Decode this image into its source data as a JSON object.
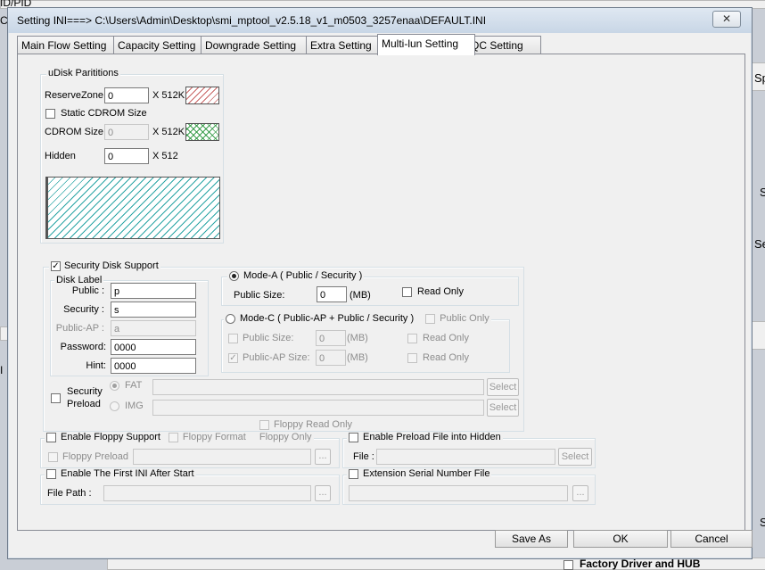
{
  "window": {
    "title": "Setting  INI===> C:\\Users\\Admin\\Desktop\\smi_mptool_v2.5.18_v1_m0503_3257enaa\\DEFAULT.INI",
    "close_glyph": "✕"
  },
  "tabs": [
    {
      "label": "Main Flow Setting"
    },
    {
      "label": "Capacity Setting"
    },
    {
      "label": "Downgrade Setting"
    },
    {
      "label": "Extra Setting"
    },
    {
      "label": "Multi-lun Setting",
      "active": true
    },
    {
      "label": "QC Setting"
    }
  ],
  "udisk": {
    "title": "uDisk Parititions",
    "reserve_label": "ReserveZone",
    "reserve_value": "0",
    "reserve_unit": "X 512K",
    "static_cdrom_label": "Static CDROM Size",
    "cdrom_label": "CDROM Size",
    "cdrom_value": "0",
    "cdrom_unit": "X 512K",
    "hidden_label": "Hidden",
    "hidden_value": "0",
    "hidden_unit": "X 512"
  },
  "security": {
    "title": "Security Disk Support",
    "checked": true,
    "disk_label_title": "Disk Label",
    "public_label": "Public :",
    "public_value": "p",
    "security_label": "Security :",
    "security_value": "s",
    "public_ap_label": "Public-AP :",
    "public_ap_value": "a",
    "password_label": "Password:",
    "password_value": "0000",
    "hint_label": "Hint:",
    "hint_value": "0000",
    "mode_a_label": "Mode-A ( Public / Security )",
    "public_size_label": "Public Size:",
    "public_size_value": "0",
    "mb_unit": "(MB)",
    "read_only_label": "Read Only",
    "mode_c_label": "Mode-C  ( Public-AP + Public / Security )",
    "public_only_label": "Public Only",
    "mode_c_public_size_label": "Public Size:",
    "mode_c_public_size_value": "0",
    "mode_c_mb_unit": "(MB)",
    "mode_c_read_only_label": "Read Only",
    "public_ap_size_label": "Public-AP Size:",
    "public_ap_size_value": "0",
    "public_ap_mb_unit": "(MB)",
    "public_ap_read_only_label": "Read Only",
    "preload_label_1": "Security",
    "preload_label_2": "Preload",
    "fat_label": "FAT",
    "img_label": "IMG",
    "select_label": "Select",
    "select_label_2": "Select"
  },
  "floppy": {
    "read_only_top_label": "Floppy Read Only",
    "enable_label": "Enable Floppy Support",
    "format_label": "Floppy Format",
    "only_label": "Floppy Only",
    "preload_label": "Floppy Preload",
    "browse_label": "..."
  },
  "preload_hidden": {
    "enable_label": "Enable Preload File into Hidden",
    "file_label": "File :",
    "select_label": "Select"
  },
  "first_ini": {
    "enable_label": "Enable The First INI After Start",
    "file_path_label": "File Path :",
    "browse_label": "..."
  },
  "ext_serial": {
    "label": "Extension Serial Number File",
    "browse_label": "..."
  },
  "footer": {
    "save_as": "Save  As",
    "ok": "OK",
    "cancel": "Cancel"
  },
  "background": {
    "top_left_1": "ID/PID",
    "top_left_2": "C",
    "right_1": "Sp",
    "right_2": "S",
    "right_3": "Se",
    "right_4": "S",
    "left_1": "I",
    "bottom_text": "Factory Driver and HUB"
  }
}
